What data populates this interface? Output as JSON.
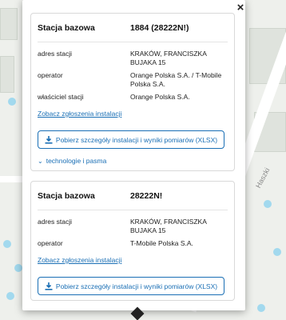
{
  "map": {
    "street_label": "Haszki"
  },
  "popup": {
    "close_label": "×",
    "cards": [
      {
        "station_label": "Stacja bazowa",
        "station_id": "1884 (28222N!)",
        "rows": [
          {
            "key": "adres stacji",
            "value": "KRAKÓW, FRANCISZKA BUJAKA 15"
          },
          {
            "key": "operator",
            "value": "Orange Polska S.A. / T-Mobile Polska S.A."
          },
          {
            "key": "właściciel stacji",
            "value": "Orange Polska S.A."
          }
        ],
        "link_label": "Zobacz zgłoszenia instalacji",
        "download_label": "Pobierz szczegóły instalacji i wyniki pomiarów (XLSX)",
        "tech_toggle_label": "technologie i pasma"
      },
      {
        "station_label": "Stacja bazowa",
        "station_id": "28222N!",
        "rows": [
          {
            "key": "adres stacji",
            "value": "KRAKÓW, FRANCISZKA BUJAKA 15"
          },
          {
            "key": "operator",
            "value": "T-Mobile Polska S.A."
          }
        ],
        "link_label": "Zobacz zgłoszenia instalacji",
        "download_label": "Pobierz szczegóły instalacji i wyniki pomiarów (XLSX)"
      }
    ]
  },
  "colors": {
    "accent": "#1a6fb5",
    "map_bg": "#eef0ec"
  }
}
